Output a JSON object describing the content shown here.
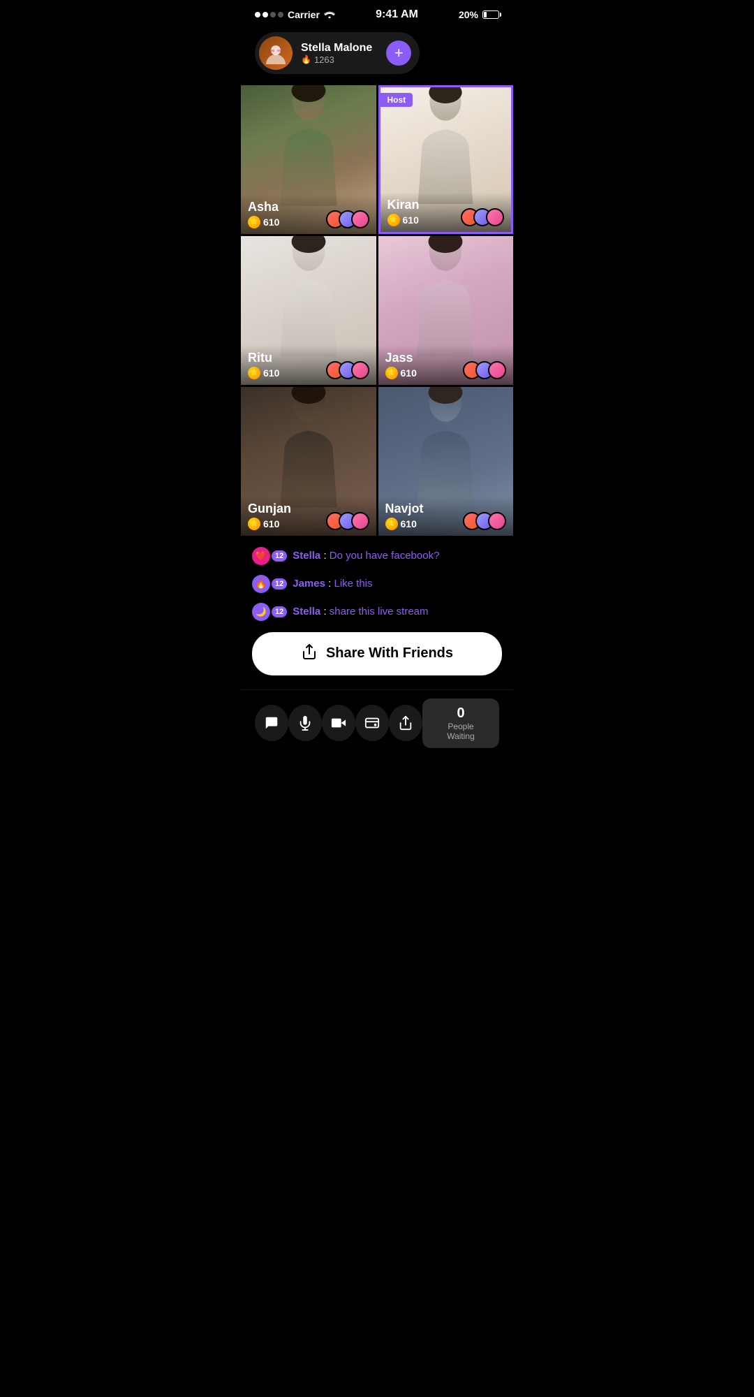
{
  "statusBar": {
    "carrier": "Carrier",
    "time": "9:41 AM",
    "battery": "20%"
  },
  "userHeader": {
    "name": "Stella Malone",
    "score": "1263",
    "addBtn": "+"
  },
  "grid": {
    "cells": [
      {
        "id": "asha",
        "name": "Asha",
        "coins": "610",
        "host": false,
        "colorClass": "cell-asha"
      },
      {
        "id": "kiran",
        "name": "Kiran",
        "coins": "610",
        "host": true,
        "colorClass": "cell-kiran"
      },
      {
        "id": "ritu",
        "name": "Ritu",
        "coins": "610",
        "host": false,
        "colorClass": "cell-ritu"
      },
      {
        "id": "jass",
        "name": "Jass",
        "coins": "610",
        "host": false,
        "colorClass": "cell-jass"
      },
      {
        "id": "gunjan",
        "name": "Gunjan",
        "coins": "610",
        "host": false,
        "colorClass": "cell-gunjan"
      },
      {
        "id": "navjot",
        "name": "Navjot",
        "coins": "610",
        "host": false,
        "colorClass": "cell-navjot"
      }
    ],
    "hostLabel": "Host"
  },
  "chat": {
    "messages": [
      {
        "user": "Stella",
        "text": "Do you have facebook?",
        "badge": "❤️",
        "badgeType": "heart",
        "level": "12"
      },
      {
        "user": "James",
        "text": "Like this",
        "badge": "🔥",
        "badgeType": "fire",
        "level": "12"
      },
      {
        "user": "Stella",
        "text": "share this live stream",
        "badge": "🌙",
        "badgeType": "fire",
        "level": "12"
      }
    ]
  },
  "shareBtn": {
    "label": "Share With Friends"
  },
  "bottomBar": {
    "icons": [
      "💬",
      "🎤",
      "📹",
      "💼",
      "📤"
    ],
    "iconNames": [
      "chat",
      "microphone",
      "video",
      "wallet",
      "share"
    ],
    "peopleWaiting": {
      "count": "0",
      "label": "People Waiting"
    }
  }
}
